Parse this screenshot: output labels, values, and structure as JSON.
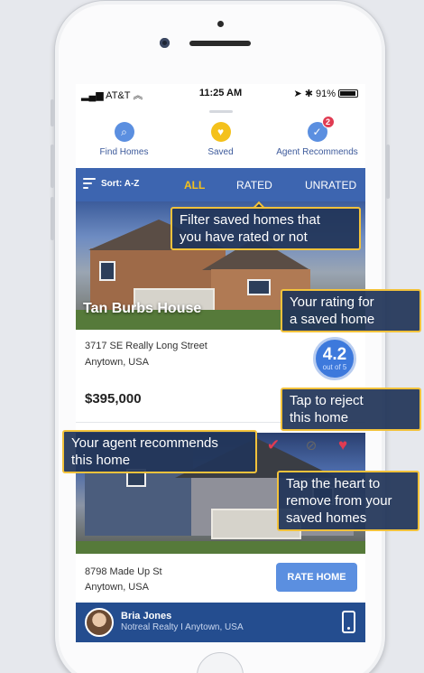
{
  "status": {
    "carrier": "AT&T",
    "time": "11:25 AM",
    "battery": "91%"
  },
  "nav": [
    {
      "label": "Find Homes",
      "icon": "search-homes-icon",
      "color": "#5b8fe0"
    },
    {
      "label": "Saved",
      "icon": "heart-icon",
      "color": "#f4c11b"
    },
    {
      "label": "Agent Recommends",
      "icon": "check-icon",
      "color": "#5b8fe0",
      "badge": "2"
    }
  ],
  "filter": {
    "sort": "Sort: A-Z",
    "tabs": [
      "ALL",
      "RATED",
      "UNRATED"
    ],
    "active": "ALL"
  },
  "listing1": {
    "title": "Tan Burbs House",
    "address_line1": "3717 SE Really Long Street",
    "address_line2": "Anytown, USA",
    "price": "$395,000",
    "rating": "4.2",
    "rating_scale": "out of 5"
  },
  "listing2": {
    "address_line1": "8798 Made Up St",
    "address_line2": "Anytown, USA",
    "rate_button": "RATE HOME"
  },
  "agent": {
    "name": "Bria Jones",
    "company": "Notreal Realty I Anytown, USA"
  },
  "tips": {
    "filter": [
      "Filter saved homes that",
      "you have rated or not"
    ],
    "rating": [
      "Your rating for",
      "a saved home"
    ],
    "reject": [
      "Tap to reject",
      "this home"
    ],
    "recommend": [
      "Your agent recommends",
      "this home"
    ],
    "remove": [
      "Tap the heart to",
      "remove from your",
      "saved homes"
    ]
  },
  "colors": {
    "accent": "#3d65b0",
    "highlight": "#f4c11b",
    "tip_border": "#f2c23b",
    "heart": "#e03b52"
  }
}
